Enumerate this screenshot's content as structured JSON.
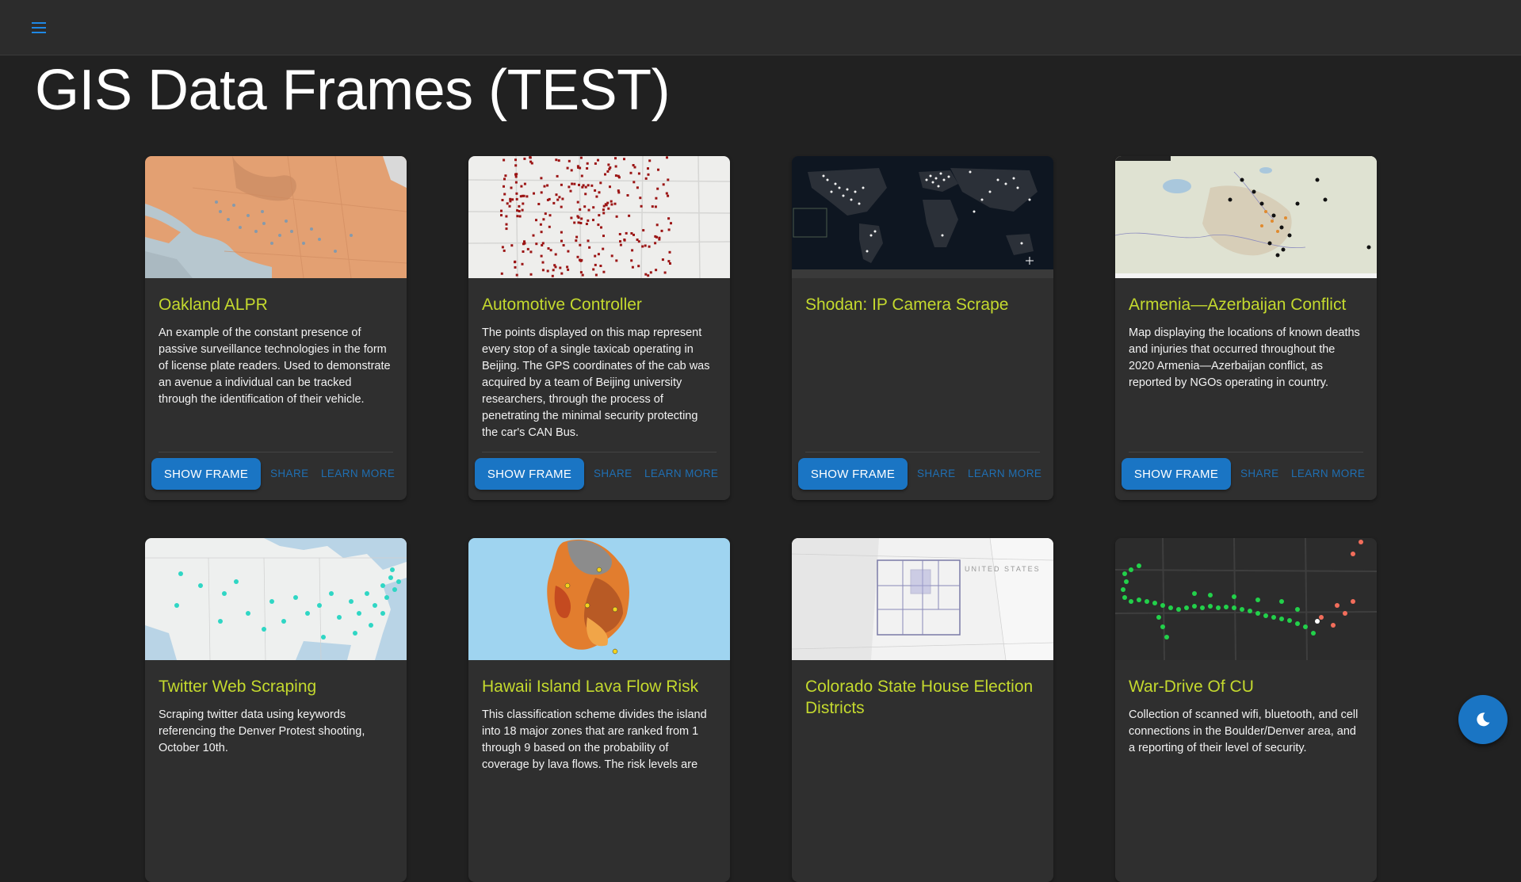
{
  "header": {
    "menu_icon": "hamburger-menu-icon"
  },
  "page": {
    "title": "GIS Data Frames (TEST)"
  },
  "actions": {
    "show_frame": "SHOW FRAME",
    "share": "SHARE",
    "learn_more": "LEARN MORE"
  },
  "cards": [
    {
      "title": "Oakland ALPR",
      "text": "An example of the constant presence of passive surveillance technologies in the form of license plate readers. Used to demonstrate an avenue a individual can be tracked through the identification of their vehicle."
    },
    {
      "title": "Automotive Controller",
      "text": "The points displayed on this map represent every stop of a single taxicab operating in Beijing. The GPS coordinates of the cab was acquired by a team of Beijing university researchers, through the process of penetrating the minimal security protecting the car's CAN Bus."
    },
    {
      "title": "Shodan: IP Camera Scrape",
      "text": ""
    },
    {
      "title": "Armenia—Azerbaijan Conflict",
      "text": "Map displaying the locations of known deaths and injuries that occurred throughout the 2020 Armenia—Azerbaijan conflict, as reported by NGOs operating in country."
    },
    {
      "title": "Twitter Web Scraping",
      "text": "Scraping twitter data using keywords referencing the Denver Protest shooting, October 10th."
    },
    {
      "title": "Hawaii Island Lava Flow Risk",
      "text": "This classification scheme divides the island into 18 major zones that are ranked from 1 through 9 based on the probability of coverage by lava flows. The risk levels are"
    },
    {
      "title": "Colorado State House Election Districts",
      "text": ""
    },
    {
      "title": "War-Drive Of CU",
      "text": "Collection of scanned wifi, bluetooth, and cell connections in the Boulder/Denver area, and a reporting of their level of security."
    }
  ],
  "map_labels": {
    "colorado_map": "UNITED STATES"
  },
  "fab": {
    "icon": "dark-mode-moon-icon"
  },
  "colors": {
    "accent": "#1a75c4",
    "card_title": "#c4d92e",
    "background": "#212121",
    "card": "#2f2f2f"
  }
}
